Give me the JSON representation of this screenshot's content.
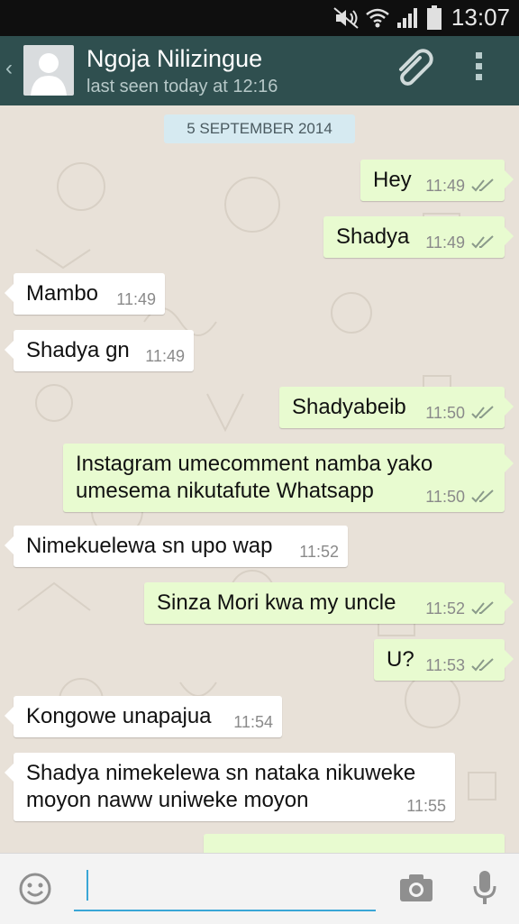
{
  "status_bar": {
    "time": "13:07"
  },
  "header": {
    "contact_name": "Ngoja Nilizingue",
    "last_seen": "last seen today at 12:16"
  },
  "chat": {
    "date": "5 SEPTEMBER 2014",
    "messages": [
      {
        "dir": "out",
        "text": "Hey",
        "time": "11:49"
      },
      {
        "dir": "out",
        "text": "Shadya",
        "time": "11:49"
      },
      {
        "dir": "in",
        "text": "Mambo",
        "time": "11:49"
      },
      {
        "dir": "in",
        "text": "Shadya gn",
        "time": "11:49"
      },
      {
        "dir": "out",
        "text": "Shadyabeib",
        "time": "11:50"
      },
      {
        "dir": "out",
        "text": "Instagram umecomment namba yako\numesema nikutafute Whatsapp",
        "time": "11:50"
      },
      {
        "dir": "in",
        "text": "Nimekuelewa sn upo wap",
        "time": "11:52"
      },
      {
        "dir": "out",
        "text": "Sinza Mori kwa my uncle",
        "time": "11:52"
      },
      {
        "dir": "out",
        "text": "U?",
        "time": "11:53"
      },
      {
        "dir": "in",
        "text": "Kongowe unapajua",
        "time": "11:54"
      },
      {
        "dir": "in",
        "text": "Shadya nimekelewa sn nataka nikuweke\nmoyon naww uniweke moyon",
        "time": "11:55"
      }
    ]
  },
  "icons": {
    "back": "back-arrow-icon",
    "attach": "paperclip-icon",
    "menu": "overflow-menu-icon",
    "emoji": "emoji-icon",
    "camera": "camera-icon",
    "mic": "microphone-icon"
  },
  "colors": {
    "header": "#2f4f4f",
    "outgoing_bubble": "#e8fbd0",
    "incoming_bubble": "#ffffff",
    "accent": "#3aa6d6"
  }
}
